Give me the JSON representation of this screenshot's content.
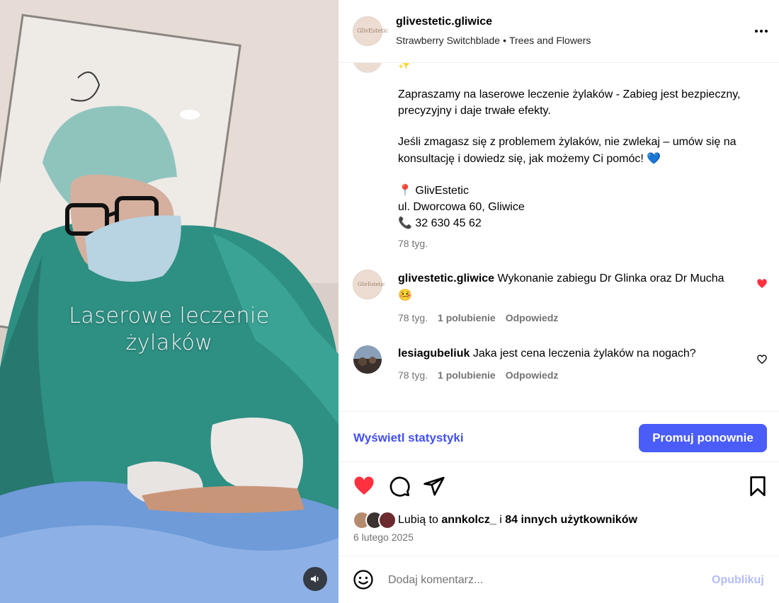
{
  "media": {
    "overlay_line1": "Laserowe leczenie",
    "overlay_line2": "żylaków",
    "audio_icon": "speaker-icon"
  },
  "header": {
    "avatar_text": "GlivEstetic",
    "username": "glivestetic.gliwice",
    "song": "Strawberry Switchblade",
    "artist": "Trees and Flowers"
  },
  "caption": {
    "sparkle": "✨",
    "paragraph1": "Zapraszamy na laserowe leczenie żylaków - Zabieg jest bezpieczny, precyzyjny i daje trwałe efekty.",
    "paragraph2": "Jeśli zmagasz się z problemem żylaków, nie zwlekaj – umów się na konsultację i dowiedz się, jak możemy Ci pomóc!",
    "blue_heart": "💙",
    "pin_emoji": "📍",
    "place": "GlivEstetic",
    "street": "ul. Dworcowa 60, Gliwice",
    "phone_emoji": "📞",
    "phone": "32 630 45 62",
    "time": "78 tyg."
  },
  "comments": [
    {
      "username": "glivestetic.gliwice",
      "text": "Wykonanie zabiegu Dr Glinka oraz Dr Mucha",
      "emoji": "🤒",
      "time": "78 tyg.",
      "likes": "1 polubienie",
      "reply": "Odpowiedz",
      "liked": true
    },
    {
      "username": "lesiagubeliuk",
      "text": "Jaka jest cena leczenia żylaków na nogach?",
      "time": "78 tyg.",
      "likes": "1 polubienie",
      "reply": "Odpowiedz",
      "liked": false
    }
  ],
  "stats": {
    "view_stats": "Wyświetl statystyki",
    "promote": "Promuj ponownie"
  },
  "likes": {
    "prefix": "Lubią to",
    "user": "annkolcz_",
    "connector": "i",
    "others": "84 innych użytkowników"
  },
  "date": "6 lutego 2025",
  "comment_box": {
    "placeholder": "Dodaj komentarz...",
    "publish": "Opublikuj"
  },
  "colors": {
    "accent": "#4a5df9",
    "link": "#4150f7",
    "like_red": "#ff3040",
    "muted": "#737373"
  }
}
